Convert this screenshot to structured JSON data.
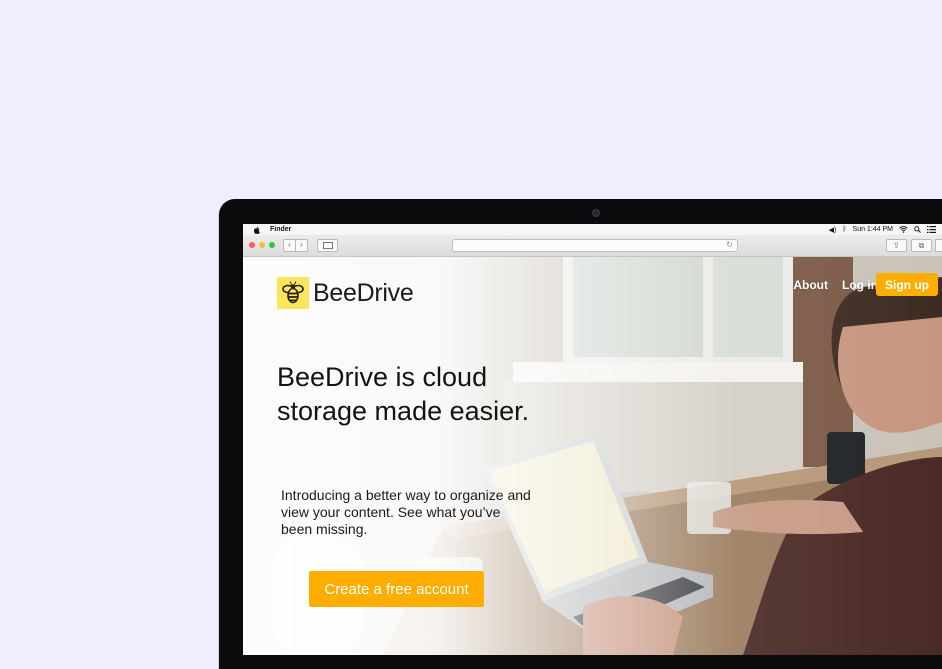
{
  "menubar": {
    "app_name": "Finder",
    "clock": "Sun 1:44 PM"
  },
  "site": {
    "logo_text": "BeeDrive",
    "nav": {
      "about": "About",
      "login": "Log in",
      "signup": "Sign up"
    },
    "headline": "BeeDrive is cloud storage made easier.",
    "subtext": "Introducing a better way to organize and view your content. See what you’ve been missing.",
    "cta": "Create a free account"
  },
  "colors": {
    "page_bg": "#efeefe",
    "accent": "#ffae00",
    "logo_bg": "#ffe45c"
  },
  "icons": [
    "apple-icon",
    "volume-icon",
    "bluetooth-icon",
    "wifi-icon",
    "search-icon",
    "list-icon",
    "bee-icon",
    "reload-icon",
    "share-icon",
    "tabs-icon"
  ]
}
